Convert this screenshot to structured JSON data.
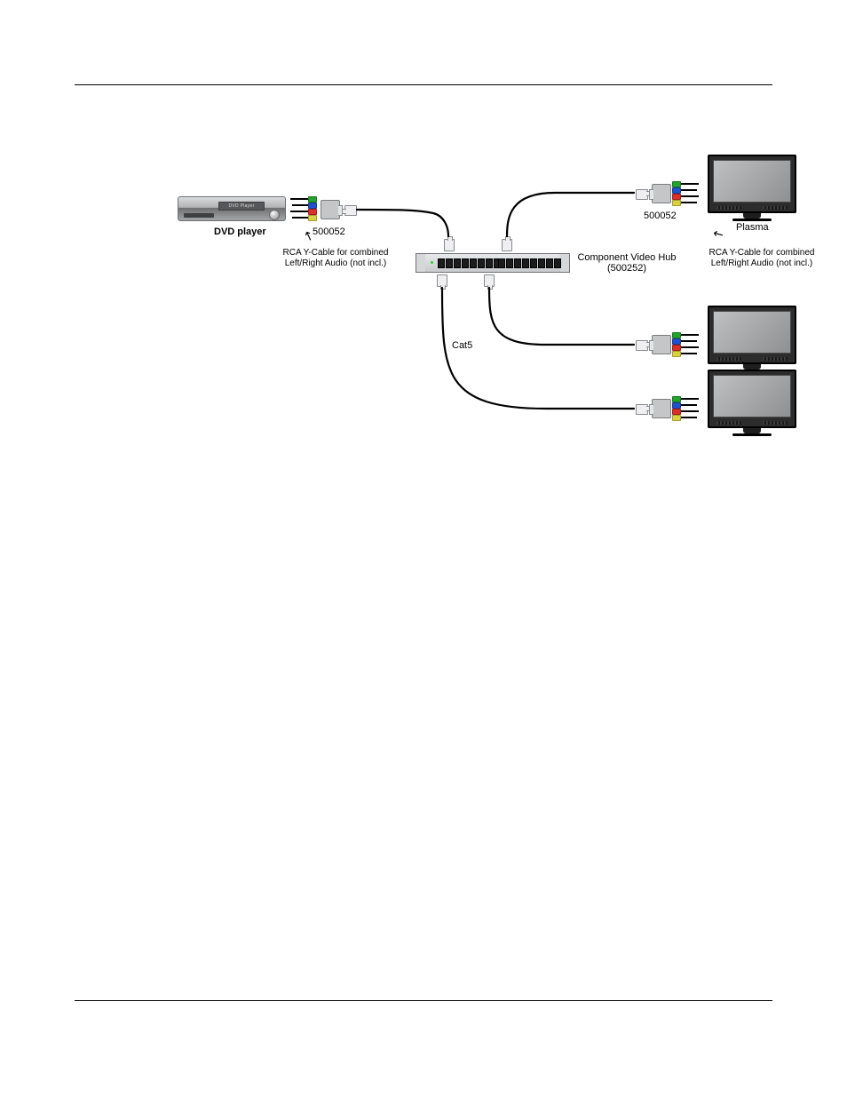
{
  "labels": {
    "dvd_player": "DVD player",
    "dvd_slot": "DVD Player",
    "src_balun_model": "500052",
    "src_ycable": "RCA Y-Cable for combined\nLeft/Right Audio (not incl.)",
    "hub_name": "Component Video Hub",
    "hub_model": "(500252)",
    "cable_type": "Cat5",
    "dst_balun_model": "500052",
    "plasma": "Plasma",
    "dst_ycable": "RCA Y-Cable for combined\nLeft/Right Audio (not incl.)"
  }
}
